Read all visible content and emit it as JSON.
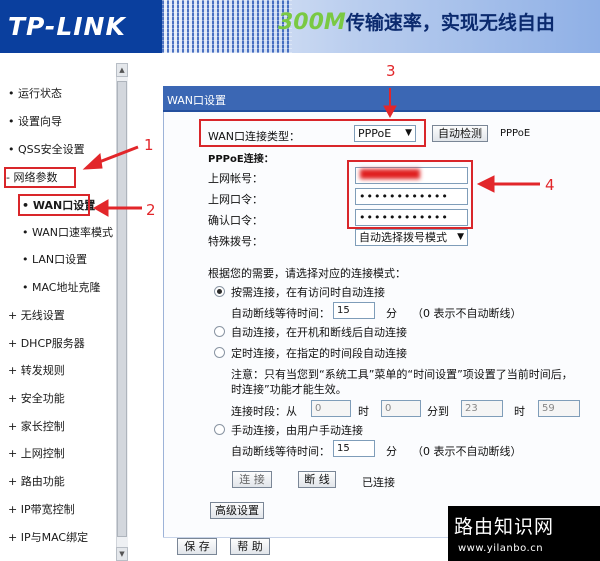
{
  "header": {
    "logo": "TP-LINK",
    "slogan_num": "300M",
    "slogan_text": "传输速率，实现无线自由"
  },
  "sidebar": {
    "items": [
      {
        "label": "• 运行状态"
      },
      {
        "label": "• 设置向导"
      },
      {
        "label": "• QSS安全设置"
      },
      {
        "label": "- 网络参数"
      },
      {
        "label": "• WAN口设置"
      },
      {
        "label": "• WAN口速率模式"
      },
      {
        "label": "• LAN口设置"
      },
      {
        "label": "• MAC地址克隆"
      },
      {
        "label": "+ 无线设置"
      },
      {
        "label": "+ DHCP服务器"
      },
      {
        "label": "+ 转发规则"
      },
      {
        "label": "+ 安全功能"
      },
      {
        "label": "+ 家长控制"
      },
      {
        "label": "+ 上网控制"
      },
      {
        "label": "+ 路由功能"
      },
      {
        "label": "+ IP带宽控制"
      },
      {
        "label": "+ IP与MAC绑定"
      }
    ]
  },
  "panel": {
    "title": "WAN口设置",
    "conn_type_label": "WAN口连接类型：",
    "conn_type_value": "PPPoE",
    "auto_detect_btn": "自动检测",
    "conn_type_note": "PPPoE",
    "pppoe_section": "PPPoE连接：",
    "account_label": "上网帐号：",
    "account_value": "",
    "password_label": "上网口令：",
    "password_value": "••••••••••••",
    "confirm_label": "确认口令：",
    "confirm_value": "••••••••••••",
    "special_dial_label": "特殊拨号：",
    "special_dial_value": "自动选择拨号模式",
    "mode_prompt": "根据您的需要，请选择对应的连接模式：",
    "mode_on_demand": "按需连接，在有访问时自动连接",
    "idle_label_1": "自动断线等待时间：",
    "idle_value_1": "15",
    "idle_unit_1": "分",
    "idle_hint_1": "（0 表示不自动断线）",
    "mode_auto": "自动连接，在开机和断线后自动连接",
    "mode_timed": "定时连接，在指定的时间段自动连接",
    "timed_note_1": "注意：只有当您到“系统工具”菜单的“时间设置”项设置了当前时间后，",
    "timed_note_2": "时连接”功能才能生效。",
    "period_label": "连接时段：从",
    "period_from_h": "0",
    "period_h1": "时",
    "period_from_m": "0",
    "period_to": "分到",
    "period_to_h": "23",
    "period_h2": "时",
    "period_to_m": "59",
    "mode_manual": "手动连接，由用户手动连接",
    "idle_label_2": "自动断线等待时间：",
    "idle_value_2": "15",
    "idle_unit_2": "分",
    "idle_hint_2": "（0 表示不自动断线）",
    "connect_btn": "连 接",
    "disconnect_btn": "断 线",
    "status_text": "已连接",
    "advanced_btn": "高级设置",
    "save_btn": "保 存",
    "help_btn": "帮 助"
  },
  "annotations": {
    "n1": "1",
    "n2": "2",
    "n3": "3",
    "n4": "4"
  },
  "watermark": {
    "title": "路由知识网",
    "url": "www.yilanbo.cn"
  },
  "colors": {
    "brand_blue": "#0a3f9e",
    "panel_title": "#3b67b4",
    "annotation_red": "#d9262a"
  }
}
